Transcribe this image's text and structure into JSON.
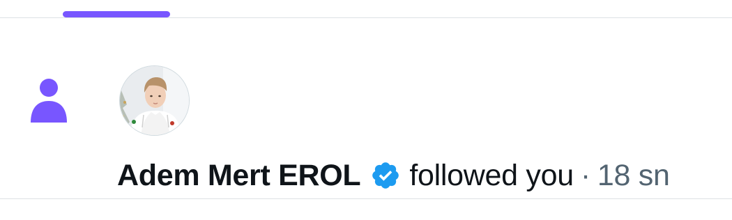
{
  "tab": {
    "indicator_color": "#7856ff"
  },
  "notification": {
    "type_icon": "person-icon",
    "type_icon_color": "#7856ff",
    "avatar": "user-avatar",
    "user_name": "Adem Mert EROL",
    "verified": true,
    "badge_icon": "verified-badge-icon",
    "badge_color": "#1d9bf0",
    "action": "followed you",
    "separator": "·",
    "time": "18 sn"
  }
}
